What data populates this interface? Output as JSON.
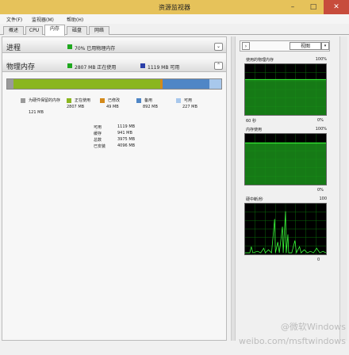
{
  "window": {
    "title": "资源监视器"
  },
  "menu": [
    "文件(F)",
    "监视器(M)",
    "帮助(H)"
  ],
  "tabs": [
    {
      "label": "概述",
      "active": false
    },
    {
      "label": "CPU",
      "active": false
    },
    {
      "label": "内存",
      "active": true
    },
    {
      "label": "磁盘",
      "active": false
    },
    {
      "label": "网络",
      "active": false
    }
  ],
  "process_section": {
    "title": "进程",
    "stat": "70% 已用物理内存",
    "stat_color": "#1fa81f"
  },
  "physical_section": {
    "title": "物理内存",
    "stat1": "2807 MB 正在使用",
    "stat1_color": "#1fa81f",
    "stat2": "1119 MB 可用",
    "stat2_color": "#2a3fa8"
  },
  "memory_bar": {
    "segments": [
      {
        "name": "hardware-reserved",
        "mb": 121,
        "color": "#9a9a9a"
      },
      {
        "name": "in-use",
        "mb": 2807,
        "color": "#8ab61f"
      },
      {
        "name": "modified",
        "mb": 49,
        "color": "#d48a1a"
      },
      {
        "name": "standby",
        "mb": 892,
        "color": "#4f86c6"
      },
      {
        "name": "free",
        "mb": 227,
        "color": "#a8c8ec"
      }
    ]
  },
  "legend": [
    {
      "label": "为硬件保留的内存",
      "value": "121 MB",
      "color": "#9a9a9a"
    },
    {
      "label": "正在使用",
      "value": "2807 MB",
      "color": "#8ab61f"
    },
    {
      "label": "已修改",
      "value": "49 MB",
      "color": "#d48a1a"
    },
    {
      "label": "备用",
      "value": "892 MB",
      "color": "#4f86c6"
    },
    {
      "label": "可用",
      "value": "227 MB",
      "color": "#a8c8ec"
    }
  ],
  "stats": [
    {
      "k": "可用",
      "v": "1119 MB"
    },
    {
      "k": "缓存",
      "v": "941 MB"
    },
    {
      "k": "总数",
      "v": "3975 MB"
    },
    {
      "k": "已安装",
      "v": "4096 MB"
    }
  ],
  "right_panel": {
    "view_label": "视图",
    "graphs": [
      {
        "title": "使用的物理内存",
        "top": "100%",
        "bottom": "0%",
        "left_bottom": "60 秒"
      },
      {
        "title": "内存使用",
        "top": "100%",
        "bottom": "0%",
        "left_bottom": ""
      },
      {
        "title": "硬中断/秒",
        "top": "100",
        "bottom": "0",
        "left_bottom": ""
      }
    ]
  },
  "watermark": {
    "line1": "@微软Windows",
    "line2": "weibo.com/msftwindows"
  }
}
